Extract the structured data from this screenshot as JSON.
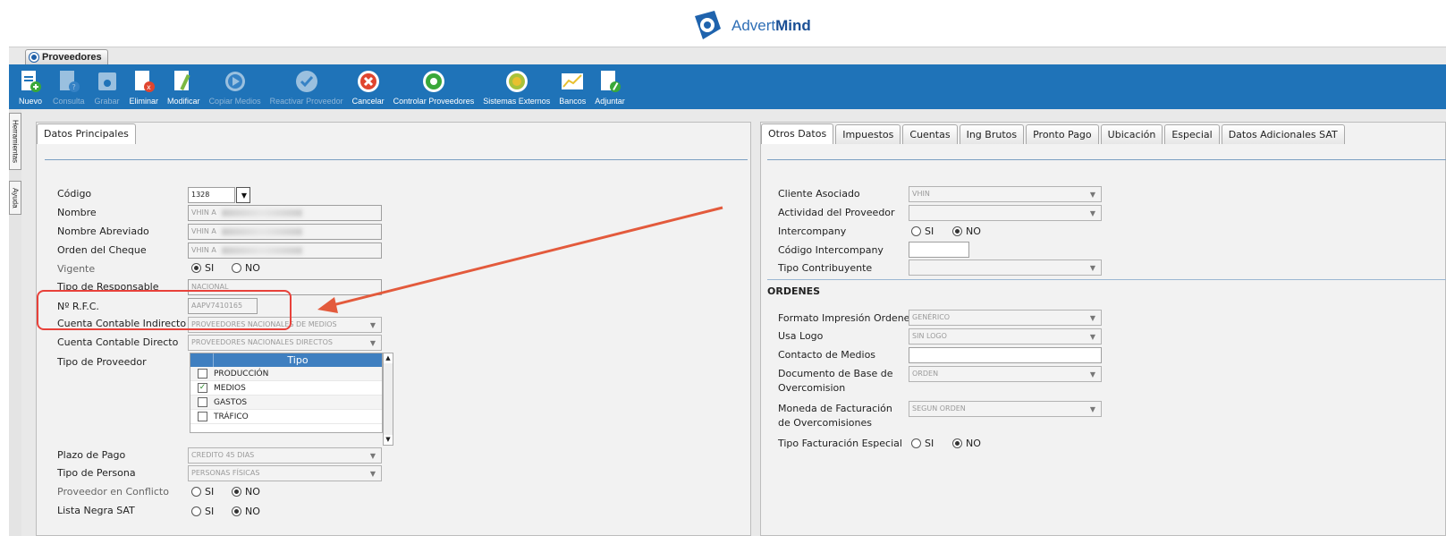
{
  "brand": {
    "name_part1": "Advert",
    "name_part2": "Mind"
  },
  "window": {
    "tab_title": "Proveedores"
  },
  "toolbar": [
    {
      "label": "Nuevo",
      "icon": "new-doc-icon",
      "enabled": true
    },
    {
      "label": "Consulta",
      "icon": "query-doc-icon",
      "enabled": false
    },
    {
      "label": "Grabar",
      "icon": "save-icon",
      "enabled": false
    },
    {
      "label": "Eliminar",
      "icon": "delete-doc-icon",
      "enabled": true
    },
    {
      "label": "Modificar",
      "icon": "edit-doc-icon",
      "enabled": true
    },
    {
      "label": "Copiar Medios",
      "icon": "copy-media-icon",
      "enabled": false
    },
    {
      "label": "Reactivar Proveedor",
      "icon": "reactivate-icon",
      "enabled": false
    },
    {
      "label": "Cancelar",
      "icon": "cancel-icon",
      "enabled": true
    },
    {
      "label": "Controlar Proveedores",
      "icon": "control-icon",
      "enabled": true
    },
    {
      "label": "Sistemas Externos",
      "icon": "external-systems-icon",
      "enabled": true
    },
    {
      "label": "Bancos",
      "icon": "banks-icon",
      "enabled": true
    },
    {
      "label": "Adjuntar",
      "icon": "attach-icon",
      "enabled": true
    }
  ],
  "side_tabs": {
    "tools": "Herramientas",
    "help": "Ayuda"
  },
  "left": {
    "tab": "Datos Principales",
    "codigo": {
      "label": "Código",
      "value": "1328"
    },
    "nombre": {
      "label": "Nombre",
      "value": "VHIN A"
    },
    "nombre_abreviado": {
      "label": "Nombre Abreviado",
      "value": "VHIN A"
    },
    "orden_cheque": {
      "label": "Orden del Cheque",
      "value": "VHIN A"
    },
    "vigente": {
      "label": "Vigente",
      "si": "SI",
      "no": "NO",
      "selected": "SI"
    },
    "tipo_responsable": {
      "label": "Tipo de Responsable",
      "value": "NACIONAL"
    },
    "rfc": {
      "label": "Nº R.F.C.",
      "value": "AAPV7410165"
    },
    "cuenta_indirecto": {
      "label": "Cuenta Contable Indirecto",
      "value": "PROVEEDORES NACIONALES DE MEDIOS"
    },
    "cuenta_directo": {
      "label": "Cuenta Contable Directo",
      "value": "PROVEEDORES NACIONALES DIRECTOS"
    },
    "tipo_proveedor": {
      "label": "Tipo de Proveedor",
      "column": "Tipo",
      "rows": [
        {
          "name": "PRODUCCIÓN",
          "checked": false
        },
        {
          "name": "MEDIOS",
          "checked": true
        },
        {
          "name": "GASTOS",
          "checked": false
        },
        {
          "name": "TRÁFICO",
          "checked": false
        }
      ]
    },
    "plazo_pago": {
      "label": "Plazo de Pago",
      "value": "CREDITO 45 DIAS"
    },
    "tipo_persona": {
      "label": "Tipo de Persona",
      "value": "PERSONAS FÍSICAS"
    },
    "conflicto": {
      "label": "Proveedor en Conflicto",
      "si": "SI",
      "no": "NO",
      "selected": "NO"
    },
    "lista_negra": {
      "label": "Lista Negra SAT",
      "si": "SI",
      "no": "NO",
      "selected": "NO"
    }
  },
  "right": {
    "tabs": [
      "Otros Datos",
      "Impuestos",
      "Cuentas",
      "Ing Brutos",
      "Pronto Pago",
      "Ubicación",
      "Especial",
      "Datos Adicionales SAT"
    ],
    "cliente_asociado": {
      "label": "Cliente Asociado",
      "value": "VHIN"
    },
    "actividad": {
      "label": "Actividad del Proveedor",
      "value": ""
    },
    "intercompany": {
      "label": "Intercompany",
      "si": "SI",
      "no": "NO",
      "selected": "NO"
    },
    "codigo_intercompany": {
      "label": "Código Intercompany",
      "value": ""
    },
    "tipo_contribuyente": {
      "label": "Tipo Contribuyente",
      "value": ""
    },
    "ordenes_title": "ORDENES",
    "formato": {
      "label": "Formato Impresión Ordenes",
      "value": "GENÉRICO"
    },
    "usa_logo": {
      "label": "Usa Logo",
      "value": "SIN LOGO"
    },
    "contacto": {
      "label": "Contacto de Medios",
      "value": ""
    },
    "documento_base": {
      "label1": "Documento de Base de",
      "label2": "Overcomision",
      "value": "ORDEN"
    },
    "moneda": {
      "label1": "Moneda de Facturación",
      "label2": "de Overcomisiones",
      "value": "SEGUN ORDEN"
    },
    "tipo_fact": {
      "label": "Tipo Facturación Especial",
      "si": "SI",
      "no": "NO",
      "selected": "NO"
    }
  },
  "colors": {
    "toolbar": "#1f73b8",
    "highlight": "#e8413a",
    "arrow": "#e35a3c"
  }
}
